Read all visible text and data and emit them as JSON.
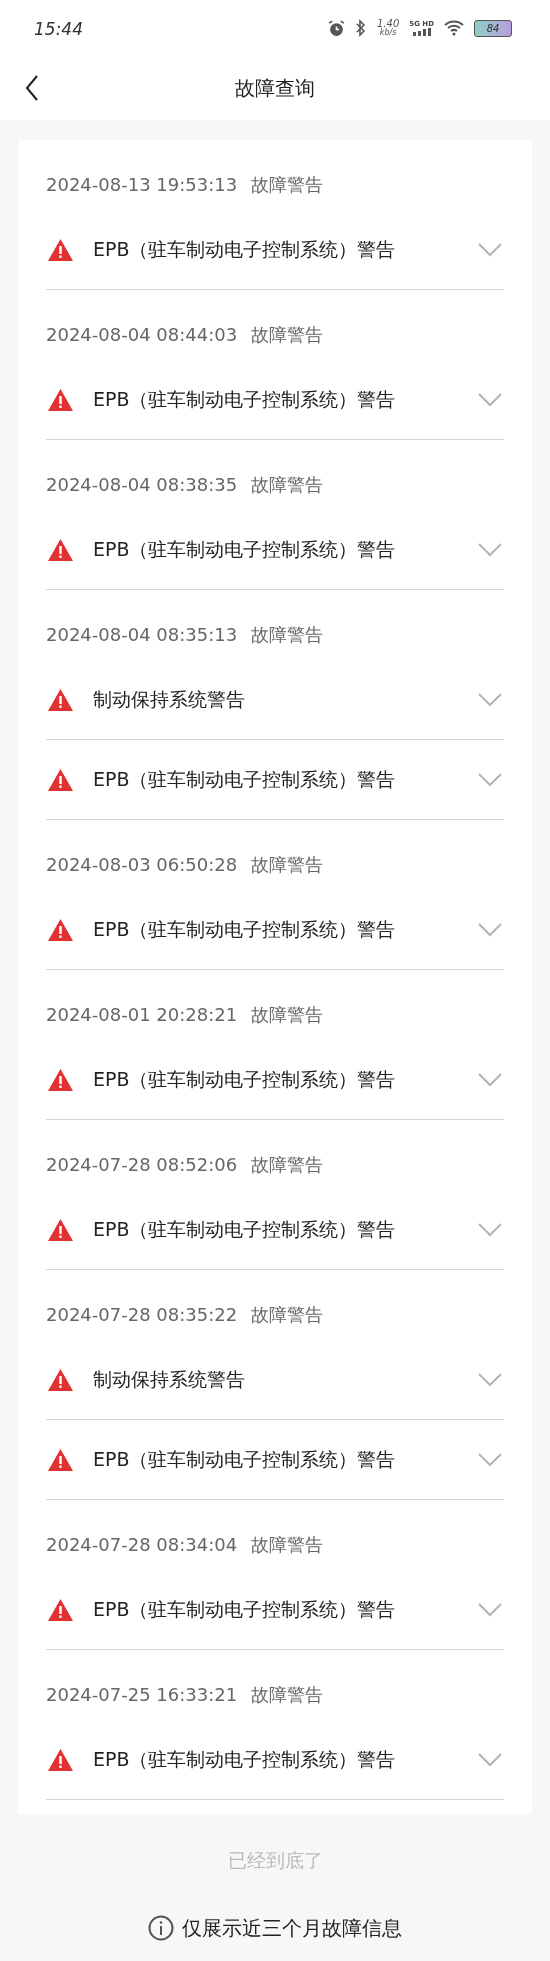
{
  "status_bar": {
    "time": "15:44",
    "speed_value": "1.40",
    "speed_unit": "kb/s",
    "network": "5G HD",
    "battery": "84"
  },
  "header": {
    "title": "故障查询"
  },
  "groups": [
    {
      "date": "2024-08-13 19:53:13",
      "type": "故障警告",
      "items": [
        {
          "title": "EPB（驻车制动电子控制系统）警告",
          "expanded": false
        }
      ]
    },
    {
      "date": "2024-08-04 08:44:03",
      "type": "故障警告",
      "items": [
        {
          "title": "EPB（驻车制动电子控制系统）警告",
          "expanded": false
        }
      ]
    },
    {
      "date": "2024-08-04 08:38:35",
      "type": "故障警告",
      "items": [
        {
          "title": "EPB（驻车制动电子控制系统）警告",
          "expanded": false
        }
      ]
    },
    {
      "date": "2024-08-04 08:35:13",
      "type": "故障警告",
      "items": [
        {
          "title": "制动保持系统警告",
          "expanded": false
        },
        {
          "title": "EPB（驻车制动电子控制系统）警告",
          "expanded": false
        }
      ]
    },
    {
      "date": "2024-08-03 06:50:28",
      "type": "故障警告",
      "items": [
        {
          "title": "EPB（驻车制动电子控制系统）警告",
          "expanded": false
        }
      ]
    },
    {
      "date": "2024-08-01 20:28:21",
      "type": "故障警告",
      "items": [
        {
          "title": "EPB（驻车制动电子控制系统）警告",
          "expanded": false
        }
      ]
    },
    {
      "date": "2024-07-28 08:52:06",
      "type": "故障警告",
      "items": [
        {
          "title": "EPB（驻车制动电子控制系统）警告",
          "expanded": false
        }
      ]
    },
    {
      "date": "2024-07-28 08:35:22",
      "type": "故障警告",
      "items": [
        {
          "title": "制动保持系统警告",
          "expanded": false
        },
        {
          "title": "EPB（驻车制动电子控制系统）警告",
          "expanded": false
        }
      ]
    },
    {
      "date": "2024-07-28 08:34:04",
      "type": "故障警告",
      "items": [
        {
          "title": "EPB（驻车制动电子控制系统）警告",
          "expanded": false
        }
      ]
    },
    {
      "date": "2024-07-25 16:33:21",
      "type": "故障警告",
      "items": [
        {
          "title": "EPB（驻车制动电子控制系统）警告",
          "expanded": false
        }
      ]
    }
  ],
  "end_text": "已经到底了",
  "notice": "仅展示近三个月故障信息"
}
